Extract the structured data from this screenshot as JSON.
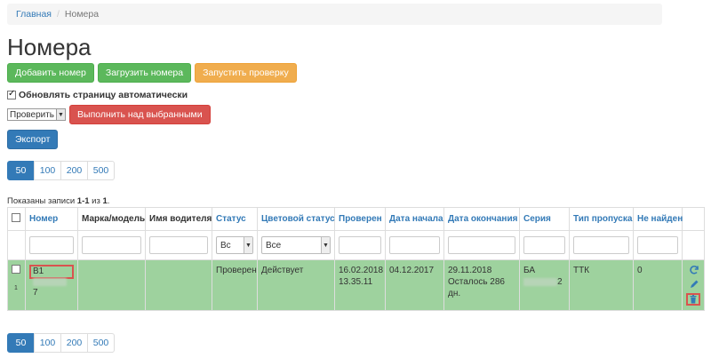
{
  "breadcrumb": {
    "home": "Главная",
    "current": "Номера"
  },
  "page_title": "Номера",
  "top_actions": {
    "add": "Добавить номер",
    "upload": "Загрузить номера",
    "run_check": "Запустить проверку"
  },
  "auto_refresh": {
    "label": "Обновлять страницу автоматически",
    "checked": true
  },
  "bulk": {
    "select_value": "Проверить",
    "run_label": "Выполнить над выбранными"
  },
  "export_label": "Экспорт",
  "page_sizes": [
    "50",
    "100",
    "200",
    "500"
  ],
  "summary": {
    "prefix": "Показаны записи ",
    "range": "1-1",
    "middle": " из ",
    "total": "1",
    "suffix": "."
  },
  "table": {
    "headers": {
      "number": "Номер",
      "make_model": "Марка/модель",
      "driver": "Имя водителя",
      "status": "Статус",
      "color_status": "Цветовой статус",
      "checked": "Проверен",
      "start_date": "Дата начала",
      "end_date": "Дата окончания",
      "series": "Серия",
      "pass_type": "Тип пропуска",
      "not_found": "Не найден"
    },
    "filters": {
      "status": "Вс",
      "color_status": "Все"
    },
    "row": {
      "index": "1",
      "number_prefix": "В1",
      "number_suffix": "7",
      "status": "Проверен",
      "color_status": "Действует",
      "checked_date": "16.02.2018",
      "checked_time": "13.35.11",
      "start_date": "04.12.2017",
      "end_date": "29.11.2018",
      "remaining": "Осталось 286 дн.",
      "series_prefix": "БА",
      "series_suffix": "2",
      "pass_type": "ТТК",
      "not_found": "0"
    }
  },
  "colors": {
    "row_bg": "#9ed29e",
    "primary": "#337ab7",
    "danger": "#d9534f"
  }
}
